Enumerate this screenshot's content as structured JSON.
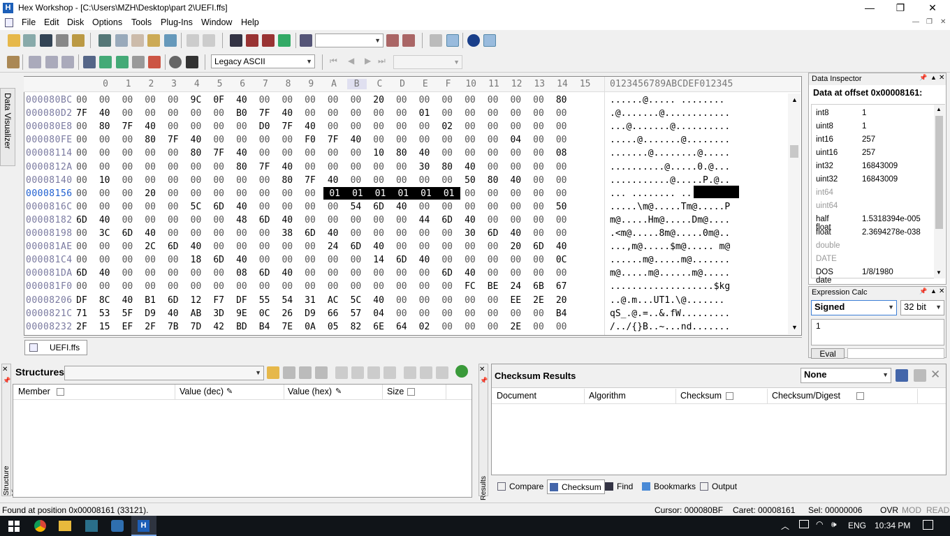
{
  "window": {
    "title": "Hex Workshop - [C:\\Users\\MZH\\Desktop\\part 2\\UEFI.ffs]",
    "minimize": "—",
    "maximize": "❐",
    "close": "✕"
  },
  "menu": [
    "File",
    "Edit",
    "Disk",
    "Options",
    "Tools",
    "Plug-Ins",
    "Window",
    "Help"
  ],
  "toolbar": {
    "encoding": "Legacy ASCII",
    "goto_value": "",
    "nav_value": ""
  },
  "side_tabs": {
    "data_visualizer": "Data Visualizer",
    "structure_viewer": "Structure Viewer",
    "results": "Results"
  },
  "hex_editor": {
    "col_headers": [
      "0",
      "1",
      "2",
      "3",
      "4",
      "5",
      "6",
      "7",
      "8",
      "9",
      "A",
      "B",
      "C",
      "D",
      "E",
      "F",
      "10",
      "11",
      "12",
      "13",
      "14",
      "15"
    ],
    "ascii_header": "0123456789ABCDEF012345",
    "rows": [
      {
        "addr": "000080BC",
        "bytes": [
          "00",
          "00",
          "00",
          "00",
          "00",
          "9C",
          "0F",
          "40",
          "00",
          "00",
          "00",
          "00",
          "00",
          "20",
          "00",
          "00",
          "00",
          "00",
          "00",
          "00",
          "00",
          "80"
        ],
        "ascii": "......@..... ........"
      },
      {
        "addr": "000080D2",
        "bytes": [
          "7F",
          "40",
          "00",
          "00",
          "00",
          "00",
          "00",
          "B0",
          "7F",
          "40",
          "00",
          "00",
          "00",
          "00",
          "00",
          "01",
          "00",
          "00",
          "00",
          "00",
          "00",
          "00"
        ],
        "ascii": ".@.......@............"
      },
      {
        "addr": "000080E8",
        "bytes": [
          "00",
          "80",
          "7F",
          "40",
          "00",
          "00",
          "00",
          "00",
          "D0",
          "7F",
          "40",
          "00",
          "00",
          "00",
          "00",
          "00",
          "02",
          "00",
          "00",
          "00",
          "00",
          "00"
        ],
        "ascii": "...@.......@.........."
      },
      {
        "addr": "000080FE",
        "bytes": [
          "00",
          "00",
          "00",
          "80",
          "7F",
          "40",
          "00",
          "00",
          "00",
          "00",
          "F0",
          "7F",
          "40",
          "00",
          "00",
          "00",
          "00",
          "00",
          "00",
          "04",
          "00",
          "00"
        ],
        "ascii": ".....@.......@........"
      },
      {
        "addr": "00008114",
        "bytes": [
          "00",
          "00",
          "00",
          "00",
          "00",
          "80",
          "7F",
          "40",
          "00",
          "00",
          "00",
          "00",
          "00",
          "10",
          "80",
          "40",
          "00",
          "00",
          "00",
          "00",
          "00",
          "08"
        ],
        "ascii": ".......@........@....."
      },
      {
        "addr": "0000812A",
        "bytes": [
          "00",
          "00",
          "00",
          "00",
          "00",
          "00",
          "00",
          "80",
          "7F",
          "40",
          "00",
          "00",
          "00",
          "00",
          "00",
          "30",
          "80",
          "40",
          "00",
          "00",
          "00",
          "00"
        ],
        "ascii": "..........@.....0.@..."
      },
      {
        "addr": "00008140",
        "bytes": [
          "00",
          "10",
          "00",
          "00",
          "00",
          "00",
          "00",
          "00",
          "00",
          "80",
          "7F",
          "40",
          "00",
          "00",
          "00",
          "00",
          "00",
          "50",
          "80",
          "40",
          "00",
          "00"
        ],
        "ascii": "...........@.....P.@.."
      },
      {
        "addr": "00008156",
        "bytes": [
          "00",
          "00",
          "00",
          "20",
          "00",
          "00",
          "00",
          "00",
          "00",
          "00",
          "00",
          "01",
          "01",
          "01",
          "01",
          "01",
          "01",
          "00",
          "00",
          "00",
          "00",
          "00"
        ],
        "ascii": "... ........ ........."
      },
      {
        "addr": "0000816C",
        "bytes": [
          "00",
          "00",
          "00",
          "00",
          "00",
          "5C",
          "6D",
          "40",
          "00",
          "00",
          "00",
          "00",
          "54",
          "6D",
          "40",
          "00",
          "00",
          "00",
          "00",
          "00",
          "00",
          "50"
        ],
        "ascii": ".....\\m@.....Tm@.....P"
      },
      {
        "addr": "00008182",
        "bytes": [
          "6D",
          "40",
          "00",
          "00",
          "00",
          "00",
          "00",
          "48",
          "6D",
          "40",
          "00",
          "00",
          "00",
          "00",
          "00",
          "44",
          "6D",
          "40",
          "00",
          "00",
          "00",
          "00"
        ],
        "ascii": "m@.....Hm@.....Dm@...."
      },
      {
        "addr": "00008198",
        "bytes": [
          "00",
          "3C",
          "6D",
          "40",
          "00",
          "00",
          "00",
          "00",
          "00",
          "38",
          "6D",
          "40",
          "00",
          "00",
          "00",
          "00",
          "00",
          "30",
          "6D",
          "40",
          "00",
          "00"
        ],
        "ascii": ".<m@.....8m@.....0m@.."
      },
      {
        "addr": "000081AE",
        "bytes": [
          "00",
          "00",
          "00",
          "2C",
          "6D",
          "40",
          "00",
          "00",
          "00",
          "00",
          "00",
          "24",
          "6D",
          "40",
          "00",
          "00",
          "00",
          "00",
          "00",
          "20",
          "6D",
          "40"
        ],
        "ascii": "...,m@.....$m@..... m@"
      },
      {
        "addr": "000081C4",
        "bytes": [
          "00",
          "00",
          "00",
          "00",
          "00",
          "18",
          "6D",
          "40",
          "00",
          "00",
          "00",
          "00",
          "00",
          "14",
          "6D",
          "40",
          "00",
          "00",
          "00",
          "00",
          "00",
          "0C"
        ],
        "ascii": "......m@.....m@......."
      },
      {
        "addr": "000081DA",
        "bytes": [
          "6D",
          "40",
          "00",
          "00",
          "00",
          "00",
          "00",
          "08",
          "6D",
          "40",
          "00",
          "00",
          "00",
          "00",
          "00",
          "00",
          "6D",
          "40",
          "00",
          "00",
          "00",
          "00"
        ],
        "ascii": "m@.....m@......m@....."
      },
      {
        "addr": "000081F0",
        "bytes": [
          "00",
          "00",
          "00",
          "00",
          "00",
          "00",
          "00",
          "00",
          "00",
          "00",
          "00",
          "00",
          "00",
          "00",
          "00",
          "00",
          "00",
          "FC",
          "BE",
          "24",
          "6B",
          "67"
        ],
        "ascii": "...................$kg"
      },
      {
        "addr": "00008206",
        "bytes": [
          "DF",
          "8C",
          "40",
          "B1",
          "6D",
          "12",
          "F7",
          "DF",
          "55",
          "54",
          "31",
          "AC",
          "5C",
          "40",
          "00",
          "00",
          "00",
          "00",
          "00",
          "EE",
          "2E",
          "20"
        ],
        "ascii": "..@.m...UT1.\\@......."
      },
      {
        "addr": "0000821C",
        "bytes": [
          "71",
          "53",
          "5F",
          "D9",
          "40",
          "AB",
          "3D",
          "9E",
          "0C",
          "26",
          "D9",
          "66",
          "57",
          "04",
          "00",
          "00",
          "00",
          "00",
          "00",
          "00",
          "00",
          "B4"
        ],
        "ascii": "qS_.@.=..&.fW........."
      },
      {
        "addr": "00008232",
        "bytes": [
          "2F",
          "15",
          "EF",
          "2F",
          "7B",
          "7D",
          "42",
          "BD",
          "B4",
          "7E",
          "0A",
          "05",
          "82",
          "6E",
          "64",
          "02",
          "00",
          "00",
          "00",
          "2E",
          "00",
          "00"
        ],
        "ascii": "/../{}B..~...nd......."
      }
    ],
    "file_tab": "UEFI.ffs"
  },
  "data_inspector": {
    "title": "Data Inspector",
    "offset_label": "Data at offset 0x00008161:",
    "rows": [
      {
        "k": "int8",
        "v": "1",
        "dim": false
      },
      {
        "k": "uint8",
        "v": "1",
        "dim": false
      },
      {
        "k": "int16",
        "v": "257",
        "dim": false
      },
      {
        "k": "uint16",
        "v": "257",
        "dim": false
      },
      {
        "k": "int32",
        "v": "16843009",
        "dim": false
      },
      {
        "k": "uint32",
        "v": "16843009",
        "dim": false
      },
      {
        "k": "int64",
        "v": "",
        "dim": true
      },
      {
        "k": "uint64",
        "v": "",
        "dim": true
      },
      {
        "k": "half float",
        "v": "1.5318394e-005",
        "dim": false
      },
      {
        "k": "float",
        "v": "2.3694278e-038",
        "dim": false
      },
      {
        "k": "double",
        "v": "",
        "dim": true
      },
      {
        "k": "DATE",
        "v": "",
        "dim": true
      },
      {
        "k": "DOS date",
        "v": "1/8/1980",
        "dim": false
      }
    ]
  },
  "expression_calc": {
    "title": "Expression Calc",
    "sign": "Signed",
    "bits": "32 bit",
    "expression": "1",
    "eval_label": "Eval"
  },
  "structures": {
    "title": "Structures",
    "selector": "",
    "columns": [
      "Member",
      "Value (dec)",
      "Value (hex)",
      "Size"
    ]
  },
  "checksum": {
    "title": "Checksum Results",
    "algorithm": "None",
    "columns": [
      "Document",
      "Algorithm",
      "Checksum",
      "Checksum/Digest"
    ],
    "tabs": [
      "Compare",
      "Checksum",
      "Find",
      "Bookmarks",
      "Output"
    ]
  },
  "status": {
    "message": "Found at position 0x00008161 (33121).",
    "cursor": "Cursor: 000080BF",
    "caret": "Caret: 00008161",
    "sel": "Sel: 00000006",
    "ovr": "OVR",
    "mod": "MOD",
    "read": "READ"
  },
  "taskbar": {
    "lang": "ENG",
    "time": "10:34 PM"
  },
  "colors": {
    "selection_bg": "#000000",
    "selection_fg": "#ffffff",
    "address": "#7a7aa0",
    "taskbar": "#101418"
  }
}
